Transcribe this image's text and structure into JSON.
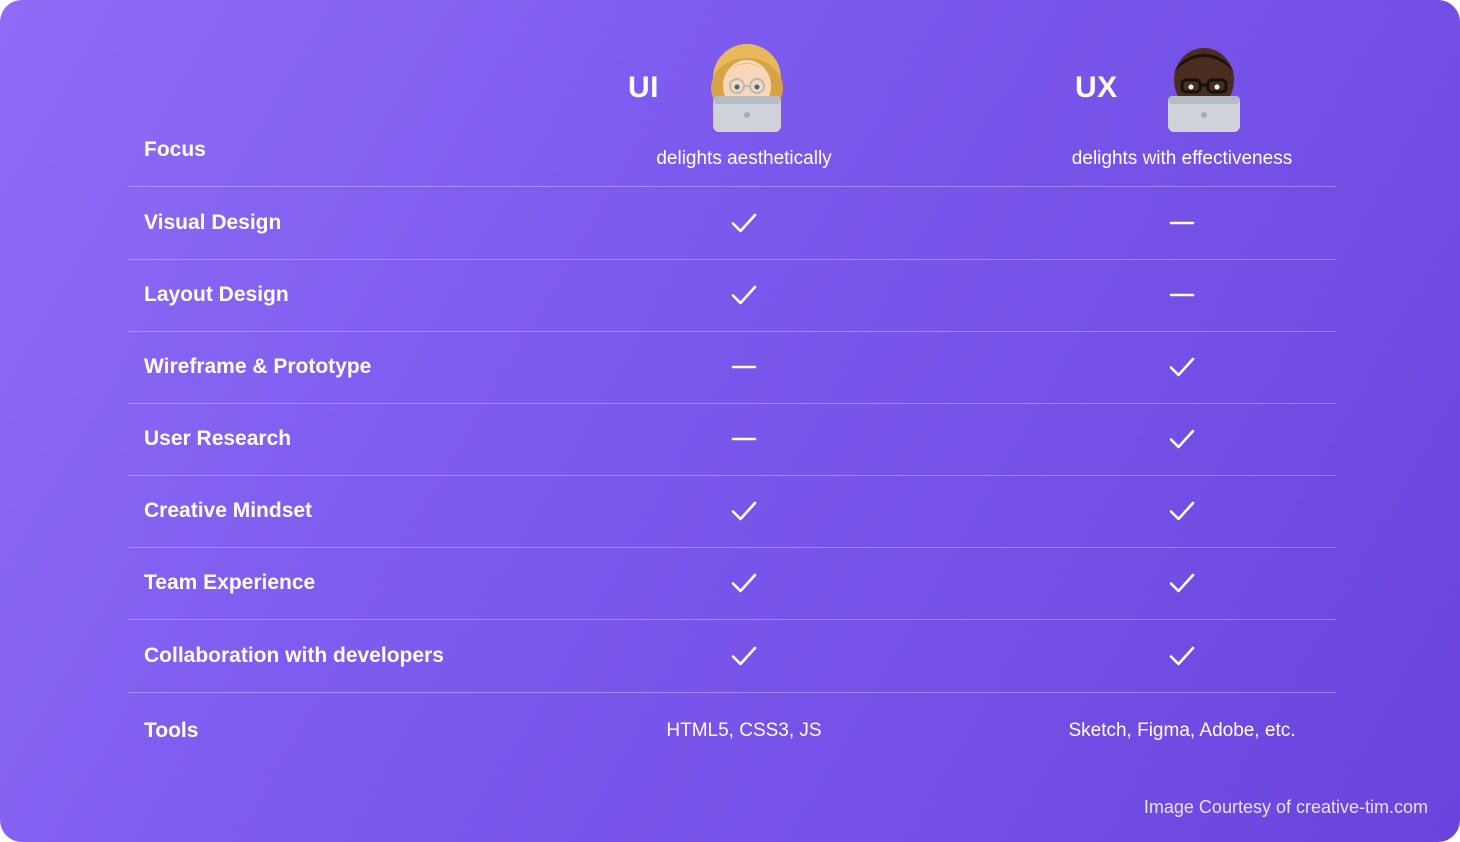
{
  "columns": {
    "ui": {
      "title": "UI",
      "avatar_icon": "memoji-laptop-light-icon"
    },
    "ux": {
      "title": "UX",
      "avatar_icon": "memoji-laptop-dark-icon"
    }
  },
  "rows": [
    {
      "label": "Focus",
      "ui_text": "delights aesthetically",
      "ux_text": "delights with effectiveness"
    },
    {
      "label": "Visual Design",
      "ui_mark": "check",
      "ux_mark": "dash"
    },
    {
      "label": "Layout Design",
      "ui_mark": "check",
      "ux_mark": "dash"
    },
    {
      "label": "Wireframe & Prototype",
      "ui_mark": "dash",
      "ux_mark": "check"
    },
    {
      "label": "User Research",
      "ui_mark": "dash",
      "ux_mark": "check"
    },
    {
      "label": "Creative Mindset",
      "ui_mark": "check",
      "ux_mark": "check"
    },
    {
      "label": "Team Experience",
      "ui_mark": "check",
      "ux_mark": "check"
    },
    {
      "label": "Collaboration with developers",
      "ui_mark": "check",
      "ux_mark": "check"
    },
    {
      "label": "Tools",
      "ui_text": "HTML5, CSS3, JS",
      "ux_text": "Sketch, Figma, Adobe, etc."
    }
  ],
  "credit": "Image Courtesy of creative-tim.com",
  "colors": {
    "gradient_start": "#8f6cf6",
    "gradient_end": "#6a44dd",
    "text": "#ffffff"
  }
}
